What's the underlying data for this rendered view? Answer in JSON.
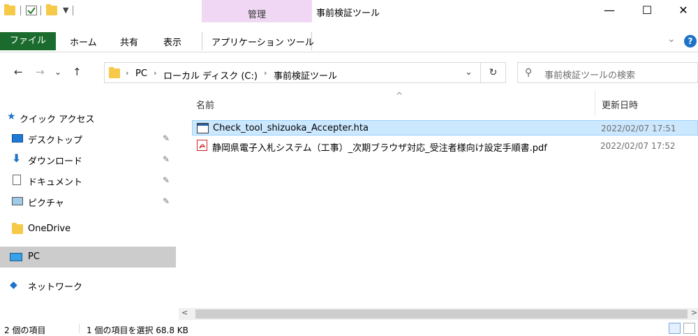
{
  "title": {
    "context_group": "管理",
    "app_title": "事前検証ツール",
    "minimize": "—",
    "maximize": "☐",
    "close": "✕"
  },
  "ribbon": {
    "tabs": [
      "ファイル",
      "ホーム",
      "共有",
      "表示"
    ],
    "context_tab": "アプリケーション ツール",
    "chevron": "⌄",
    "help": "?"
  },
  "nav": {
    "back": "←",
    "forward": "→",
    "recent": "⌄",
    "up": "↑",
    "breadcrumb": [
      "PC",
      "ローカル ディスク (C:)",
      "事前検証ツール"
    ],
    "breadcrumb_sep": "›",
    "dropdown": "⌄",
    "refresh": "↻",
    "search_placeholder": "事前検証ツールの検索",
    "search_icon": "⚲"
  },
  "sidebar": {
    "quick_access": "クイック アクセス",
    "items": [
      {
        "label": "デスクトップ",
        "icon": "desktop-icon",
        "pinned": true
      },
      {
        "label": "ダウンロード",
        "icon": "download-icon",
        "pinned": true
      },
      {
        "label": "ドキュメント",
        "icon": "document-icon",
        "pinned": true
      },
      {
        "label": "ピクチャ",
        "icon": "picture-icon",
        "pinned": true
      }
    ],
    "onedrive": "OneDrive",
    "pc": "PC",
    "network": "ネットワーク",
    "pin_glyph": "✎"
  },
  "columns": {
    "name": "名前",
    "modified": "更新日時",
    "sort_glyph": "^"
  },
  "files": [
    {
      "name": "Check_tool_shizuoka_Accepter.hta",
      "modified": "2022/02/07 17:51",
      "selected": true,
      "icon": "hta-file-icon"
    },
    {
      "name": "静岡県電子入札システム（工事）_次期ブラウザ対応_受注者様向け設定手順書.pdf",
      "modified": "2022/02/07 17:52",
      "selected": false,
      "icon": "pdf-file-icon"
    }
  ],
  "scroll": {
    "left": "<",
    "right": ">"
  },
  "status": {
    "item_count": "2 個の項目",
    "selection": "1 個の項目を選択 68.8 KB"
  },
  "colors": {
    "file_tab": "#1b6b2e",
    "context_tab": "#f0d8f4",
    "selection": "#cce8ff",
    "selection_border": "#99d1ff",
    "nav_selected": "#cccccc"
  }
}
